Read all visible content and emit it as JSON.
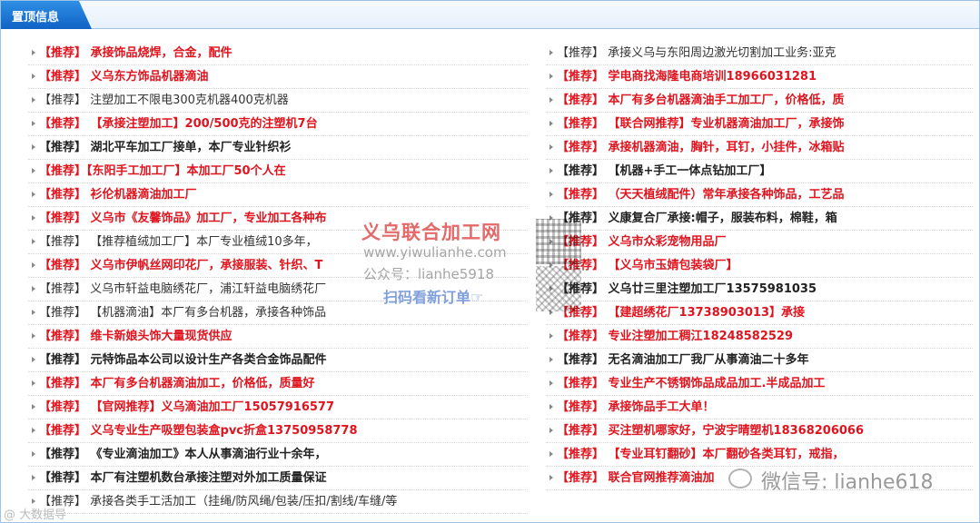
{
  "header": {
    "title": "置顶信息"
  },
  "colors": {
    "accent_red": "#e0141e",
    "header_blue": "#1a73d4",
    "border": "#9ec3e6"
  },
  "left_items": [
    {
      "text": "【推荐】 承接饰品烧焊，合金，配件",
      "style": "red"
    },
    {
      "text": "【推荐】 义乌东方饰品机器滴油",
      "style": "red"
    },
    {
      "text": "【推荐】 注塑加工不限电300克机器400克机器",
      "style": "dark"
    },
    {
      "text": "【推荐】 【承接注塑加工】200/500克的注塑机7台",
      "style": "red"
    },
    {
      "text": "【推荐】 湖北平车加工厂接单，本厂专业针织衫",
      "style": "bold-dark"
    },
    {
      "text": "【推荐】【东阳手工加工厂】本加工厂50个人在",
      "style": "red"
    },
    {
      "text": "【推荐】 衫伦机器滴油加工厂",
      "style": "red"
    },
    {
      "text": "【推荐】 义乌市《友馨饰品》加工厂，专业加工各种布",
      "style": "red"
    },
    {
      "text": "【推荐】 【推荐植绒加工厂】本厂专业植绒10多年，",
      "style": "dark"
    },
    {
      "text": "【推荐】 义乌市伊帆丝网印花厂，承接服装、针织、T",
      "style": "red"
    },
    {
      "text": "【推荐】 义乌市轩益电脑绣花厂，浦江轩益电脑绣花厂",
      "style": "dark"
    },
    {
      "text": "【推荐】 【机器滴油】本厂有多台机器，承接各种饰品",
      "style": "dark"
    },
    {
      "text": "【推荐】 维卡新娘头饰大量现货供应",
      "style": "red"
    },
    {
      "text": "【推荐】 元特饰品本公司以设计生产各类合金饰品配件",
      "style": "bold-dark"
    },
    {
      "text": "【推荐】 本厂有多台机器滴油加工，价格低，质量好",
      "style": "red"
    },
    {
      "text": "【推荐】 【官网推荐】义乌滴油加工厂15057916577",
      "style": "red"
    },
    {
      "text": "【推荐】 义乌专业生产吸塑包装盒pvc折盒13750958778",
      "style": "red"
    },
    {
      "text": "【推荐】 《专业滴油加工》本人从事滴油行业十余年，",
      "style": "bold-dark"
    },
    {
      "text": "【推荐】 本厂有注塑机数台承接注塑对外加工质量保证",
      "style": "bold-dark"
    },
    {
      "text": "【推荐】 承接各类手工活加工（挂绳/防风绳/包装/压扣/割线/车缝/等",
      "style": "dark"
    }
  ],
  "right_items": [
    {
      "text": "【推荐】 承接义乌与东阳周边激光切割加工业务:亚克",
      "style": "dark"
    },
    {
      "text": "【推荐】 学电商找海隆电商培训18966031281",
      "style": "red"
    },
    {
      "text": "【推荐】 本厂有多台机器滴油手工加工厂，价格低，质",
      "style": "red"
    },
    {
      "text": "【推荐】 【联合网推荐】专业机器滴油加工厂，承接饰",
      "style": "red"
    },
    {
      "text": "【推荐】 承接机器滴油，胸针，耳钉，小挂件，冰箱贴",
      "style": "red"
    },
    {
      "text": "【推荐】 【机器+手工一体点钻加工厂】",
      "style": "bold-dark"
    },
    {
      "text": "【推荐】 （天天植绒配件）常年承接各种饰品，工艺品",
      "style": "red"
    },
    {
      "text": "【推荐】 义康复合厂承接:帽子，服装布料，棉鞋，箱",
      "style": "bold-dark"
    },
    {
      "text": "【推荐】 义乌市众彩宠物用品厂",
      "style": "red"
    },
    {
      "text": "【推荐】 【义乌市玉婧包装袋厂】",
      "style": "red"
    },
    {
      "text": "【推荐】 义乌廿三里注塑加工厂13575981035",
      "style": "bold-dark"
    },
    {
      "text": "【推荐】 【建超绣花厂13738903013】承接",
      "style": "red"
    },
    {
      "text": "【推荐】 专业注塑加工稠江18248582529",
      "style": "red"
    },
    {
      "text": "【推荐】 无名滴油加工厂我厂从事滴油二十多年",
      "style": "bold-dark"
    },
    {
      "text": "【推荐】 专业生产不锈钢饰品成品加工.半成品加工",
      "style": "red"
    },
    {
      "text": "【推荐】 承接饰品手工大单！",
      "style": "red"
    },
    {
      "text": "【推荐】 买注塑机哪家好，宁波宇晴塑机18368206066",
      "style": "red"
    },
    {
      "text": "【推荐】 【专业耳钉翻砂】本厂翻砂各类耳钉，戒指，",
      "style": "red"
    },
    {
      "text": "【推荐】 联合官网推荐滴油加",
      "style": "red"
    }
  ],
  "watermark": {
    "title": "义乌联合加工网",
    "url": "www.yiwulianhe.com",
    "gzh": "公众号：lianhe5918",
    "scan": "扫码看新订单☞"
  },
  "wechat": {
    "text": "微信号: lianhe618",
    "icon": "wechat-icon"
  },
  "corner_watermark": "@ 大数据导"
}
